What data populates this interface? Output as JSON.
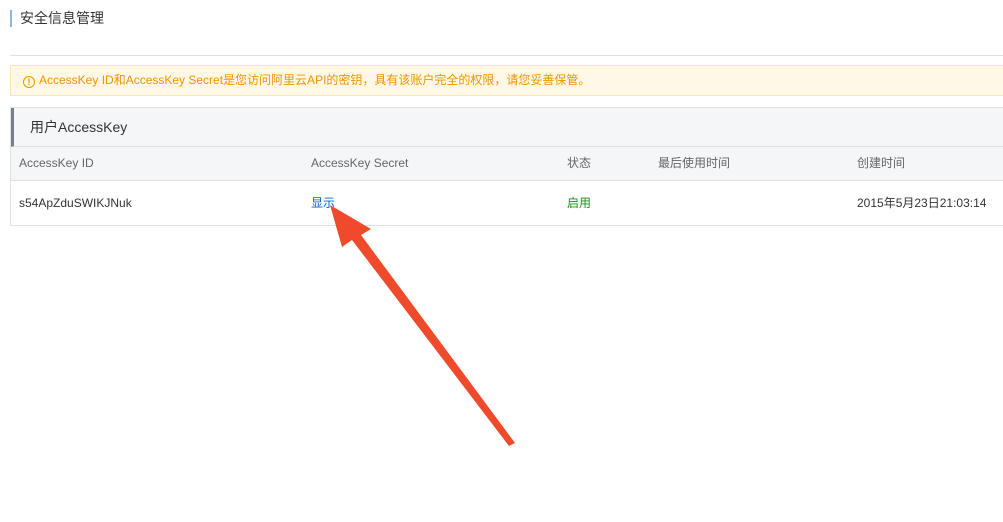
{
  "page": {
    "title": "安全信息管理"
  },
  "notice": {
    "icon": "warning-icon",
    "text": "AccessKey ID和AccessKey Secret是您访问阿里云API的密钥，具有该账户完全的权限，请您妥善保管。",
    "color": "#f09400"
  },
  "panel": {
    "title": "用户AccessKey",
    "columns": {
      "id": "AccessKey ID",
      "secret": "AccessKey Secret",
      "status": "状态",
      "last_used": "最后使用时间",
      "created": "创建时间"
    },
    "rows": [
      {
        "id": "s54ApZduSWIKJNuk",
        "secret_action": "显示",
        "status": "启用",
        "last_used": "",
        "created": "2015年5月23日21:03:14"
      }
    ]
  },
  "annotation": {
    "icon": "red-arrow-icon",
    "color": "#ee4a2b"
  }
}
